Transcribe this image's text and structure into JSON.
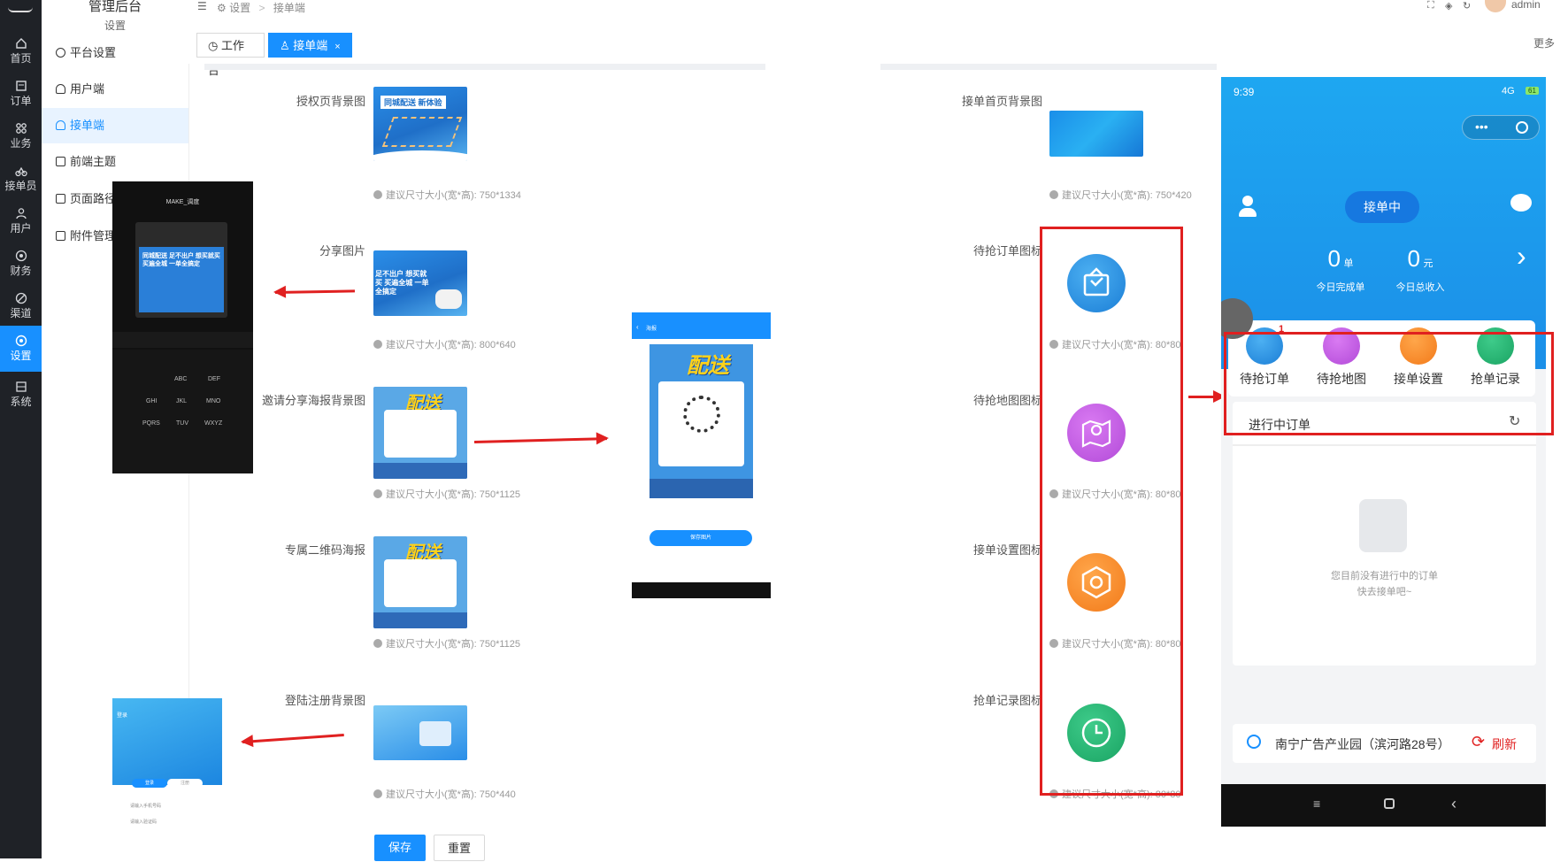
{
  "app": {
    "title": "管理后台",
    "subtitle": "设置"
  },
  "rail": [
    {
      "label": "首页",
      "icon": "home-icon"
    },
    {
      "label": "订单",
      "icon": "order-icon"
    },
    {
      "label": "业务",
      "icon": "business-icon"
    },
    {
      "label": "接单员",
      "icon": "rider-icon"
    },
    {
      "label": "用户",
      "icon": "user-icon"
    },
    {
      "label": "财务",
      "icon": "finance-icon"
    },
    {
      "label": "渠道",
      "icon": "channel-icon"
    },
    {
      "label": "设置",
      "icon": "settings-icon",
      "active": true
    },
    {
      "label": "系统",
      "icon": "system-icon"
    }
  ],
  "submenu": [
    {
      "label": "平台设置"
    },
    {
      "label": "用户端"
    },
    {
      "label": "接单端",
      "active": true
    },
    {
      "label": "前端主题"
    },
    {
      "label": "页面路径"
    },
    {
      "label": "附件管理"
    }
  ],
  "breadcrumb": {
    "root": "设置",
    "sep": ">",
    "current": "接单端"
  },
  "topbar": {
    "user": "admin"
  },
  "tabs": {
    "workbench": "工作台",
    "current": "接单端",
    "more": "更多"
  },
  "form_left": [
    {
      "label": "授权页背景图",
      "hint": "建议尺寸大小(宽*高): 750*1334"
    },
    {
      "label": "分享图片",
      "hint": "建议尺寸大小(宽*高): 800*640"
    },
    {
      "label": "邀请分享海报背景图",
      "hint": "建议尺寸大小(宽*高): 750*1125"
    },
    {
      "label": "专属二维码海报",
      "hint": "建议尺寸大小(宽*高): 750*1125"
    },
    {
      "label": "登陆注册背景图",
      "hint": "建议尺寸大小(宽*高): 750*440"
    }
  ],
  "form_right": [
    {
      "label": "接单首页背景图",
      "hint": "建议尺寸大小(宽*高): 750*420"
    },
    {
      "label": "待抢订单图标",
      "hint": "建议尺寸大小(宽*高): 80*80"
    },
    {
      "label": "待抢地图图标",
      "hint": "建议尺寸大小(宽*高): 80*80"
    },
    {
      "label": "接单设置图标",
      "hint": "建议尺寸大小(宽*高): 80*80"
    },
    {
      "label": "抢单记录图标",
      "hint": "建议尺寸大小(宽*高): 80*80"
    }
  ],
  "thumbs": {
    "auth": "同城配送 新体验",
    "share": "足不出户 想买就买 买遍全城 一单全搞定",
    "poster": "配送"
  },
  "buttons": {
    "save": "保存",
    "reset": "重置"
  },
  "center_preview": {
    "title": "海报",
    "poster": "配送",
    "save": "保存图片"
  },
  "chat_preview": {
    "title": "MAKE_调度",
    "message": "同城配送 足不出户 想买就买 买遍全城 一单全搞定",
    "keys": [
      "ABC",
      "DEF",
      "GHI",
      "JKL",
      "MNO",
      "PQRS",
      "TUV",
      "WXYZ"
    ]
  },
  "login_preview": {
    "title": "登录",
    "tab1": "登录",
    "tab2": "注册",
    "field1": "请输入手机号码",
    "field2": "请输入验证码"
  },
  "phone": {
    "time": "9:39",
    "signal": "4G",
    "battery": "61",
    "status": "接单中",
    "done_count": "0",
    "done_unit": "单",
    "done_label": "今日完成单",
    "income": "0",
    "income_unit": "元",
    "income_label": "今日总收入",
    "grid": [
      {
        "label": "待抢订单",
        "badge": "1"
      },
      {
        "label": "待抢地图"
      },
      {
        "label": "接单设置"
      },
      {
        "label": "抢单记录"
      }
    ],
    "orders_title": "进行中订单",
    "empty_line1": "您目前没有进行中的订单",
    "empty_line2": "快去接单吧~",
    "location": "南宁广告产业园（滨河路28号）",
    "refresh": "刷新"
  },
  "colors": {
    "primary": "#1890ff",
    "annotation": "#e02020",
    "rail": "#1f2227"
  }
}
